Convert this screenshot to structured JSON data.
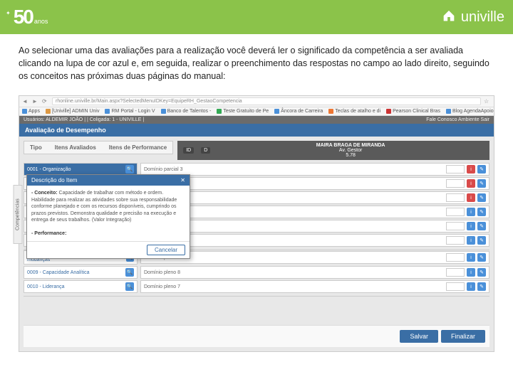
{
  "header": {
    "logo_number": "50",
    "logo_sub": "anos",
    "brand": "univille"
  },
  "instructions": "Ao selecionar uma das avaliações para a realização você deverá ler o significado da competência a ser avaliada clicando na lupa de cor azul e, em seguida, realizar o preenchimento das respostas no campo ao lado direito, seguindo os conceitos nas próximas duas páginas do manual:",
  "browser": {
    "url": "rhonline.univille.br/Main.aspx?SelectedMenuIDKey=EquipeRH_GestaoCompetencia",
    "bookmarks": [
      "Apps",
      "[Univille] ADMIN Univ",
      "RM Portal - Login V",
      "Banco de Talentos -",
      "Teste Gratuito de Pe",
      "Âncora de Carreira",
      "Teclas de atalho e di",
      "Pearson Clinical Bras",
      "Blog AgendaApoio A"
    ]
  },
  "app": {
    "topbar_left": "Usuários: ALDEMIR JOÃO | | Coligada: 1 - UNIVILLE |",
    "topbar_right": "Fale Conosco   Ambiente   Sair",
    "section_title": "Avaliação de Desempenho"
  },
  "eval": {
    "cols": {
      "tipo": "Tipo",
      "itens": "Itens Avaliados",
      "perf": "Itens de Performance"
    },
    "person_id_a": "ID",
    "person_id_b": "D",
    "person_name": "MAIRA BRAGA DE MIRANDA",
    "score_label": "Av. Gestor",
    "score_value": "5.78",
    "side_tab": "Competências",
    "rows": [
      {
        "code": "0001 - Organização",
        "domain": "Domínio parcial 3",
        "red": true
      },
      {
        "code": "",
        "domain": "ncia 1",
        "red": true
      },
      {
        "code": "",
        "domain": "erado 2",
        "red": true
      },
      {
        "code": "",
        "domain": "",
        "red": false
      },
      {
        "code": "",
        "domain": "",
        "red": false
      },
      {
        "code": "",
        "domain": "",
        "red": false
      },
      {
        "code": "0008 - Flexibilidade e abertura para mudanças",
        "domain": "Domínio pleno 8",
        "red": false
      },
      {
        "code": "0009 - Capacidade Analítica",
        "domain": "Domínio pleno 8",
        "red": false
      },
      {
        "code": "0010 - Liderança",
        "domain": "Domínio pleno 7",
        "red": false
      }
    ]
  },
  "modal": {
    "title": "Descrição do Item",
    "concept_label": "- Conceito:",
    "concept_text": " Capacidade de trabalhar com método e ordem. Habilidade para realizar as atividades sobre sua responsabilidade conforme planejado e com os recursos disponíveis, cumprindo os prazos previstos. Demonstra qualidade e precisão na execução e entrega de seus trabalhos. (Valor Integração)",
    "perf_label": "- Performance:",
    "cancel": "Cancelar"
  },
  "actions": {
    "save": "Salvar",
    "finish": "Finalizar"
  }
}
